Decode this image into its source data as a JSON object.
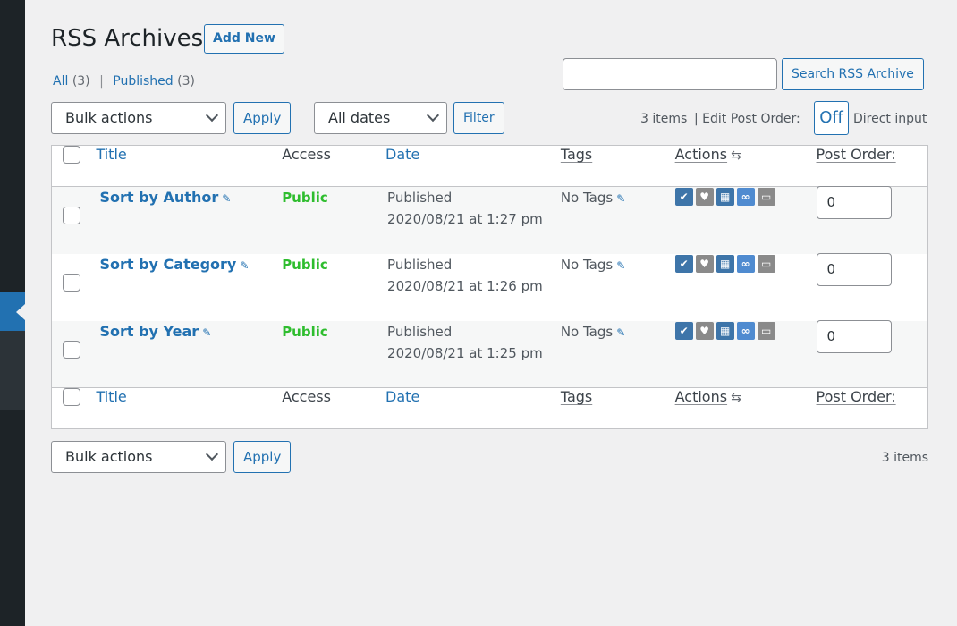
{
  "page": {
    "title": "RSS Archives",
    "add_new": "Add New"
  },
  "views": {
    "all_label": "All",
    "all_count": "(3)",
    "separator": "|",
    "published_label": "Published",
    "published_count": "(3)"
  },
  "search": {
    "value": "",
    "button": "Search RSS Archive"
  },
  "toolbar": {
    "bulk_actions": "Bulk actions",
    "apply": "Apply",
    "dates": "All dates",
    "filter": "Filter",
    "items_count": "3 items",
    "edit_post_order": "| Edit Post Order:",
    "toggle": "Off",
    "direct_input": "Direct input"
  },
  "table": {
    "columns": {
      "title": "Title",
      "access": "Access",
      "date": "Date",
      "tags": "Tags",
      "actions": "Actions",
      "actions_arrows": "⇆",
      "post_order": "Post Order:"
    },
    "rows": [
      {
        "title": "Sort by Author",
        "access": "Public",
        "status": "Published",
        "date": "2020/08/21 at 1:27 pm",
        "tags": "No Tags",
        "order": "0"
      },
      {
        "title": "Sort by Category",
        "access": "Public",
        "status": "Published",
        "date": "2020/08/21 at 1:26 pm",
        "tags": "No Tags",
        "order": "0"
      },
      {
        "title": "Sort by Year",
        "access": "Public",
        "status": "Published",
        "date": "2020/08/21 at 1:25 pm",
        "tags": "No Tags",
        "order": "0"
      }
    ],
    "action_icons": {
      "check": "✔",
      "heart": "♥",
      "calendar": "▦",
      "link": "🔗",
      "comment": "▬"
    }
  },
  "footer": {
    "bulk_actions": "Bulk actions",
    "apply": "Apply",
    "items_count": "3 items"
  },
  "colors": {
    "accent": "#2271b1",
    "public_green": "#2ebd2e",
    "sidebar": "#1d2327"
  }
}
